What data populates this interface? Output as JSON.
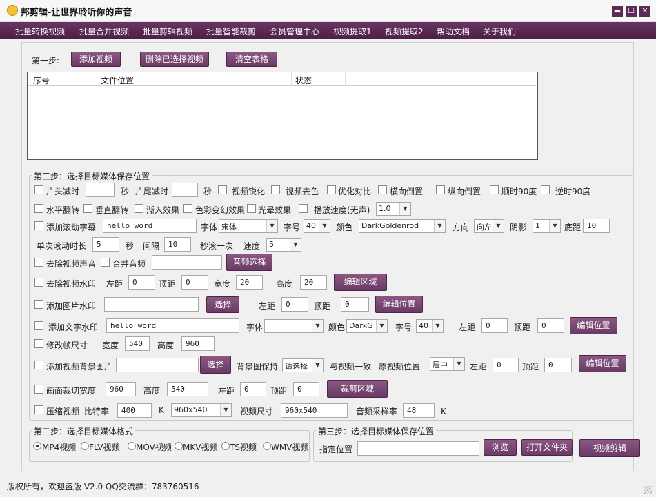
{
  "app": {
    "title": "邦剪辑-让世界聆听你的声音"
  },
  "window_controls": {
    "minimize": "▬",
    "maximize": "☐",
    "close": "✕"
  },
  "menu": [
    "批量转换视频",
    "批量合并视频",
    "批量剪辑视频",
    "批量智能裁剪",
    "会员管理中心",
    "视频提取1",
    "视频提取2",
    "帮助文档",
    "关于我们"
  ],
  "step1": {
    "label": "第一步:",
    "add": "添加视频",
    "delete": "删除已选择视频",
    "clear": "清空表格",
    "table_headers": [
      "序号",
      "文件位置",
      "状态"
    ]
  },
  "step3": {
    "title": "第三步：选择目标媒体保存位置",
    "r1": {
      "head_cut": "片头减时",
      "head_val": "",
      "sec1": "秒",
      "tail_cut": "片尾减时",
      "tail_val": "",
      "sec2": "秒",
      "sharpen": "视频锐化",
      "decolor": "视频去色",
      "contrast": "优化对比",
      "hflip_inv": "横向倒置",
      "vflip_inv": "纵向倒置",
      "cw90": "顺时90度",
      "ccw90": "逆时90度"
    },
    "r2": {
      "hflip": "水平翻转",
      "vflip": "垂直翻转",
      "fadein": "渐入效果",
      "colorfx": "色彩变幻效果",
      "glow": "光晕效果",
      "speed": "播放速度(无声)",
      "speed_val": "1.0"
    },
    "r3": {
      "scroll_sub": "添加滚动字幕",
      "text": "hello word",
      "font_lbl": "字体",
      "font": "宋体",
      "size_lbl": "字号",
      "size": "40",
      "color_lbl": "颜色",
      "color": "DarkGoldenrod",
      "dir_lbl": "方向",
      "dir": "向左",
      "shadow_lbl": "阴影",
      "shadow": "1",
      "bottom_lbl": "底距",
      "bottom": "10"
    },
    "r4": {
      "dur_lbl": "单次滚动时长",
      "dur": "5",
      "sec": "秒",
      "gap_lbl": "间隔",
      "gap": "10",
      "per_lbl": "秒滚一次",
      "speed_lbl": "速度",
      "speed": "5"
    },
    "r5": {
      "remove_audio": "去除视频声音",
      "merge_audio": "合并音频",
      "audio_path": "",
      "audio_btn": "音频选择"
    },
    "r6": {
      "remove_wm": "去除视频水印",
      "left_lbl": "左距",
      "left": "0",
      "top_lbl": "顶距",
      "top": "0",
      "w_lbl": "宽度",
      "w": "20",
      "h_lbl": "高度",
      "h": "20",
      "edit_btn": "编辑区域"
    },
    "r7": {
      "img_wm": "添加图片水印",
      "path": "",
      "select_btn": "选择",
      "left_lbl": "左距",
      "left": "0",
      "top_lbl": "顶距",
      "top": "0",
      "edit_btn": "编辑位置"
    },
    "r8": {
      "text_wm": "添加文字水印",
      "text": "hello word",
      "font_lbl": "字体",
      "font": "",
      "color_lbl": "颜色",
      "color": "DarkG",
      "size_lbl": "字号",
      "size": "40",
      "left_lbl": "左距",
      "left": "0",
      "top_lbl": "顶距",
      "top": "0",
      "edit_btn": "编辑位置"
    },
    "r9": {
      "resize": "修改帧尺寸",
      "w_lbl": "宽度",
      "w": "540",
      "h_lbl": "高度",
      "h": "960"
    },
    "r10": {
      "bg_img": "添加视频背景图片",
      "path": "",
      "select_btn": "选择",
      "keep_lbl": "背景图保持",
      "keep": "请选择",
      "same_lbl": "与视频一致",
      "pos_lbl": "原视频位置",
      "pos": "居中",
      "left_lbl": "左距",
      "left": "0",
      "top_lbl": "顶距",
      "top": "0",
      "edit_btn": "编辑位置"
    },
    "r11": {
      "crop": "画面裁切宽度",
      "w": "960",
      "h_lbl": "高度",
      "h": "540",
      "left_lbl": "左距",
      "left": "0",
      "top_lbl": "顶距",
      "top": "0",
      "crop_btn": "裁剪区域"
    },
    "r12": {
      "compress": "压缩视频",
      "bitrate_lbl": "比特率",
      "bitrate": "400",
      "k1": "K",
      "size_sel": "960x540",
      "vsize_lbl": "视频尺寸",
      "vsize": "960x540",
      "asr_lbl": "音频采样率",
      "asr": "48",
      "k2": "K"
    }
  },
  "step2": {
    "title": "第二步：选择目标媒体格式",
    "formats": [
      "MP4视频",
      "FLV视频",
      "MOV视频",
      "MKV视频",
      "TS视频",
      "WMV视频"
    ],
    "selected": 0
  },
  "step3b": {
    "title": "第三步：选择目标媒体保存位置",
    "path_lbl": "指定位置",
    "path": "",
    "browse": "浏览",
    "open_folder": "打开文件夹",
    "process": "视频剪辑"
  },
  "status": {
    "text": "版权所有，欢迎盗版 V2.0 QQ交流群：783760516"
  }
}
